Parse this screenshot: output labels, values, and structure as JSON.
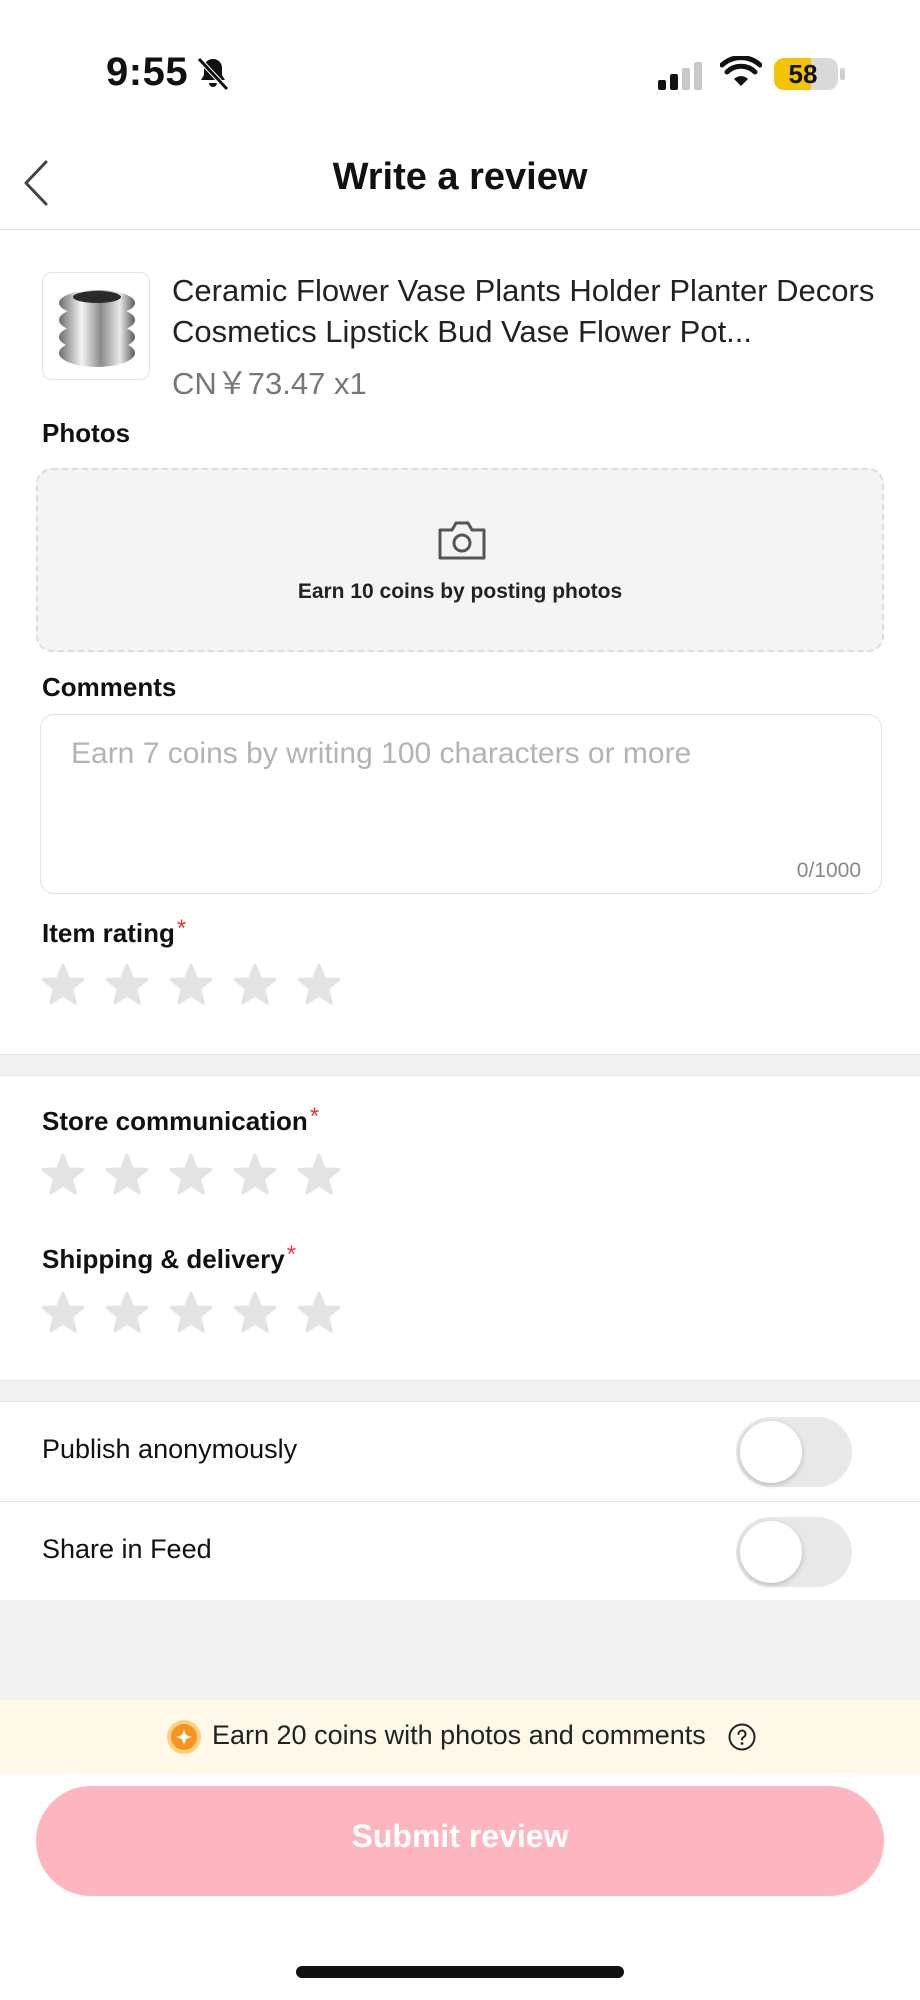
{
  "status_bar": {
    "time": "9:55",
    "battery": "58",
    "battery_level": 0.58
  },
  "nav": {
    "title": "Write a review"
  },
  "product": {
    "title": "Ceramic Flower Vase Plants Holder Planter Decors Cosmetics Lipstick Bud Vase Flower Pot...",
    "price": "CN￥73.47 x1"
  },
  "photos": {
    "label": "Photos",
    "hint": "Earn 10 coins by posting photos"
  },
  "comments": {
    "label": "Comments",
    "placeholder": "Earn 7 coins by writing 100 characters or more",
    "count": "0/1000"
  },
  "ratings": [
    {
      "label": "Item rating",
      "required_mark": "*",
      "stars": 0,
      "max": 5
    },
    {
      "label": "Store communication",
      "required_mark": "*",
      "stars": 0,
      "max": 5
    },
    {
      "label": "Shipping & delivery",
      "required_mark": "*",
      "stars": 0,
      "max": 5
    }
  ],
  "toggles": [
    {
      "label": "Publish anonymously",
      "on": false
    },
    {
      "label": "Share in Feed",
      "on": false
    }
  ],
  "coins_banner": {
    "text": "Earn 20 coins with photos and comments"
  },
  "submit": {
    "label": "Submit review"
  },
  "colors": {
    "accent_pink": "#fdb6bf",
    "required_red": "#e0393e",
    "coin_orange": "#f7931e",
    "battery_yellow": "#f5c400"
  }
}
